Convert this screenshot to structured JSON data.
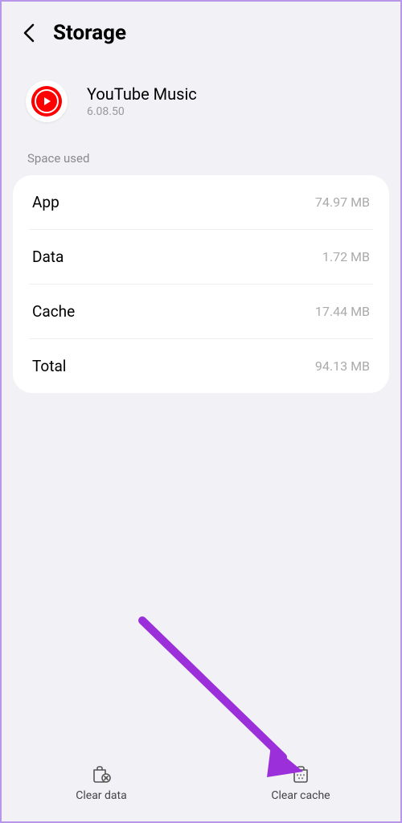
{
  "header": {
    "title": "Storage"
  },
  "app": {
    "name": "YouTube Music",
    "version": "6.08.50"
  },
  "section": {
    "label": "Space used"
  },
  "rows": [
    {
      "label": "App",
      "value": "74.97 MB"
    },
    {
      "label": "Data",
      "value": "1.72 MB"
    },
    {
      "label": "Cache",
      "value": "17.44 MB"
    },
    {
      "label": "Total",
      "value": "94.13 MB"
    }
  ],
  "actions": {
    "clear_data": "Clear data",
    "clear_cache": "Clear cache"
  }
}
